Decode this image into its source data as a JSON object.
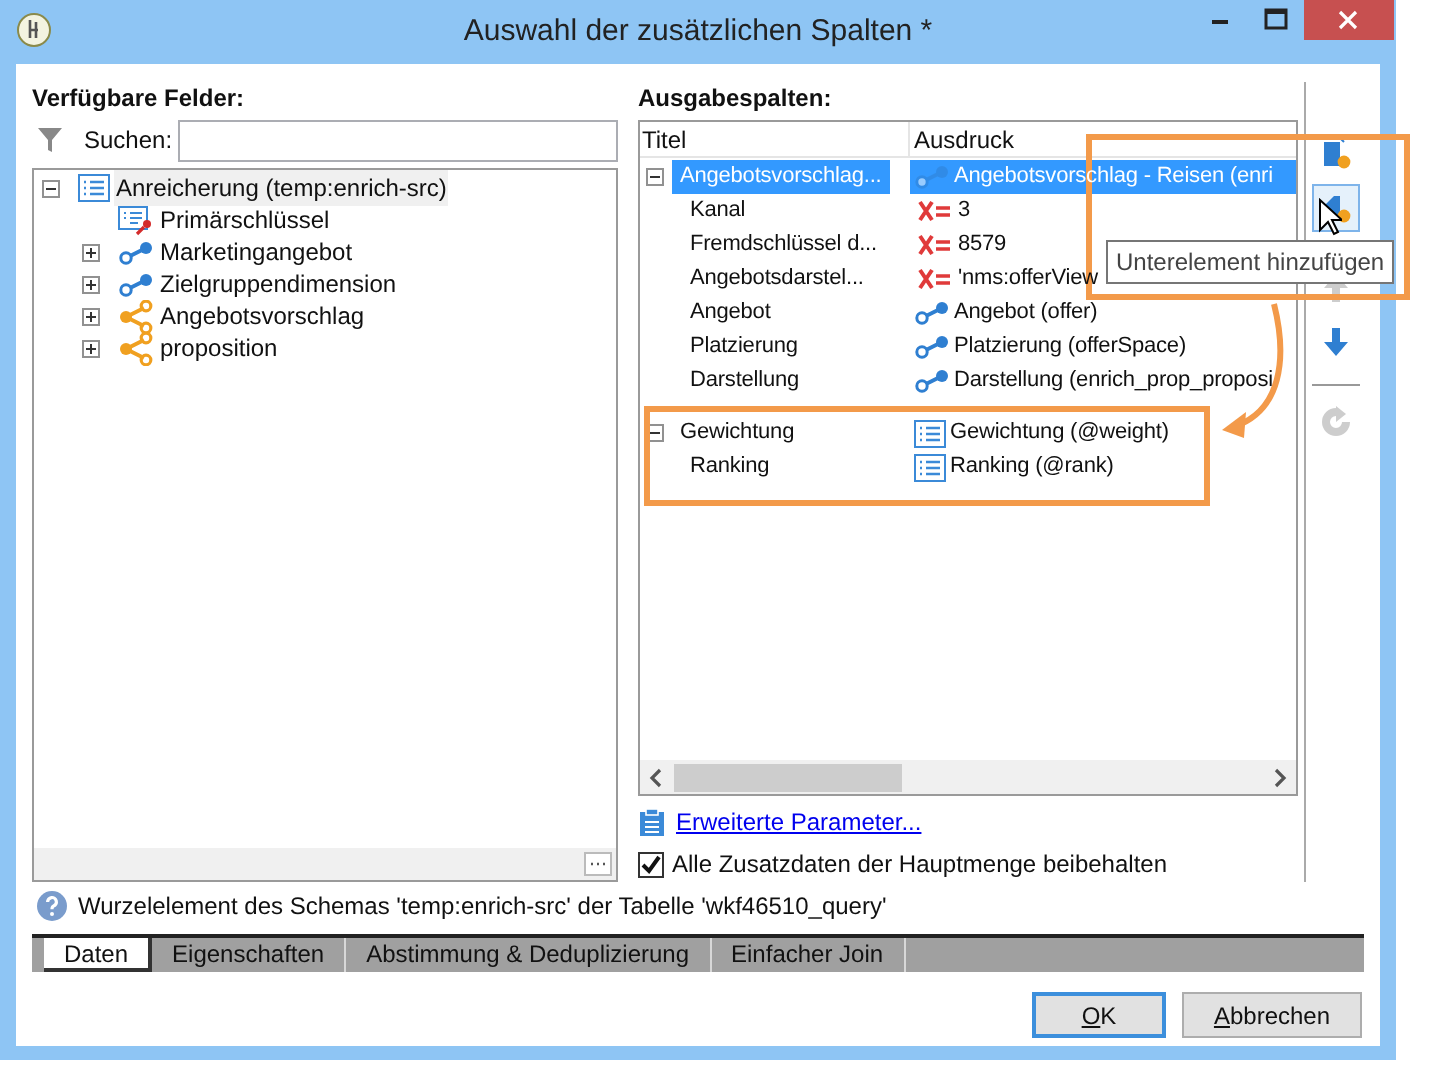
{
  "window": {
    "title": "Auswahl der zusätzlichen Spalten *"
  },
  "available_fields": {
    "label": "Verfügbare Felder:",
    "search": {
      "label": "Suchen:"
    },
    "tree": [
      {
        "label": "Anreicherung (temp:enrich-src)",
        "kind": "list",
        "expanded": true,
        "selected": true,
        "children": [
          {
            "label": "Primärschlüssel",
            "kind": "key",
            "selected": false
          },
          {
            "label": "Marketingangebot",
            "kind": "link",
            "expanded": false,
            "selected": false
          },
          {
            "label": "Zielgruppendimension",
            "kind": "link",
            "expanded": false,
            "selected": false
          },
          {
            "label": "Angebotsvorschlag",
            "kind": "collection",
            "expanded": false,
            "selected": false
          },
          {
            "label": "proposition",
            "kind": "collection",
            "expanded": false,
            "selected": false
          }
        ]
      }
    ]
  },
  "output_columns": {
    "label": "Ausgabespalten:",
    "columns": [
      "Titel",
      "Ausdruck"
    ],
    "rows": [
      {
        "title": "Angebotsvorschlag...",
        "expression": "Angebotsvorschlag - Reisen (enri",
        "kind": "link",
        "expanded": true,
        "selected": true,
        "children": [
          {
            "title": "Kanal",
            "expression": "3",
            "kind": "formula",
            "selected": false
          },
          {
            "title": "Fremdschlüssel d...",
            "expression": "8579",
            "kind": "formula",
            "selected": false
          },
          {
            "title": "Angebotsdarstel...",
            "expression": "'nms:offerView",
            "kind": "formula",
            "selected": false
          },
          {
            "title": "Angebot",
            "expression": "Angebot (offer)",
            "kind": "link",
            "selected": false
          },
          {
            "title": "Platzierung",
            "expression": "Platzierung (offerSpace)",
            "kind": "link",
            "selected": false
          },
          {
            "title": "Darstellung",
            "expression": "Darstellung (enrich_prop_proposi",
            "kind": "link",
            "selected": false
          }
        ]
      },
      {
        "title": "Gewichtung",
        "expression": "Gewichtung (@weight)",
        "kind": "field",
        "expanded": true,
        "selected": false,
        "children": [
          {
            "title": "Ranking",
            "expression": "Ranking (@rank)",
            "kind": "field",
            "selected": false
          }
        ]
      }
    ]
  },
  "toolbar": [
    {
      "kind": "add",
      "disabled": false
    },
    {
      "kind": "add_child",
      "disabled": false
    },
    {
      "kind": "up",
      "disabled": true
    },
    {
      "kind": "down",
      "disabled": false
    },
    {
      "kind": "refresh",
      "disabled": true
    }
  ],
  "tooltip": "Unterelement hinzufügen",
  "advanced_link": "Erweiterte Parameter...",
  "keep_checkbox": {
    "label": "Alle Zusatzdaten der Hauptmenge beibehalten",
    "checked": true
  },
  "info": "Wurzelelement des Schemas 'temp:enrich-src' der Tabelle 'wkf46510_query'",
  "tabs": [
    {
      "label": "Daten",
      "selected": true
    },
    {
      "label": "Eigenschaften",
      "selected": false
    },
    {
      "label": "Abstimmung & Deduplizierung",
      "selected": false
    },
    {
      "label": "Einfacher Join",
      "selected": false
    }
  ],
  "buttons": [
    {
      "label": "OK",
      "default": true
    },
    {
      "label": "Abbrechen",
      "default": false
    }
  ]
}
